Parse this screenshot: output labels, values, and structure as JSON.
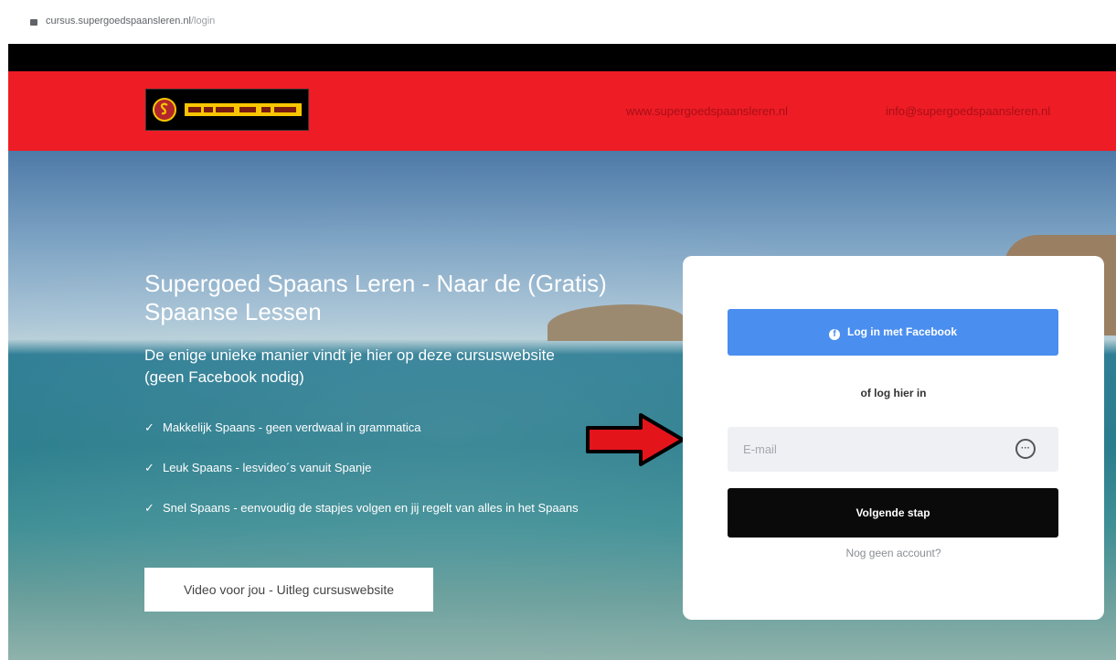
{
  "browser": {
    "url_host": "cursus.supergoedspaansleren.nl",
    "url_path": "/login",
    "lock_icon": "lock-icon"
  },
  "header": {
    "logo_text": "SUPERGOED SPAANS LEREN",
    "links": [
      "www.supergoedspaansleren.nl",
      "info@supergoedspaansleren.nl"
    ],
    "colors": {
      "bar": "#ee1c25",
      "top": "#000000",
      "link": "#a80f18"
    }
  },
  "hero": {
    "title": "Supergoed Spaans Leren - Naar de (Gratis) Spaanse Lessen",
    "subtitle": "De enige unieke manier vindt je hier op deze cursuswebsite (geen Facebook nodig)",
    "check_icon": "checkmark-icon",
    "bullets": [
      "Makkelijk Spaans - geen verdwaal in grammatica",
      "Leuk Spaans - lesvideo´s vanuit Spanje",
      "Snel Spaans - eenvoudig de stapjes volgen en jij regelt van alles in het Spaans"
    ],
    "video_button": "Video voor jou - Uitleg cursuswebsite"
  },
  "login": {
    "facebook_button": "Log in met Facebook",
    "or_label": "of log hier in",
    "email_placeholder": "E-mail",
    "email_value": "",
    "next_button": "Volgende stap",
    "signup_link": "Nog geen account?",
    "colors": {
      "facebook": "#4a8ef0",
      "next": "#0a0a0a"
    }
  },
  "annotation": {
    "arrow_icon": "red-arrow-icon",
    "arrow_color": "#e4141b"
  }
}
